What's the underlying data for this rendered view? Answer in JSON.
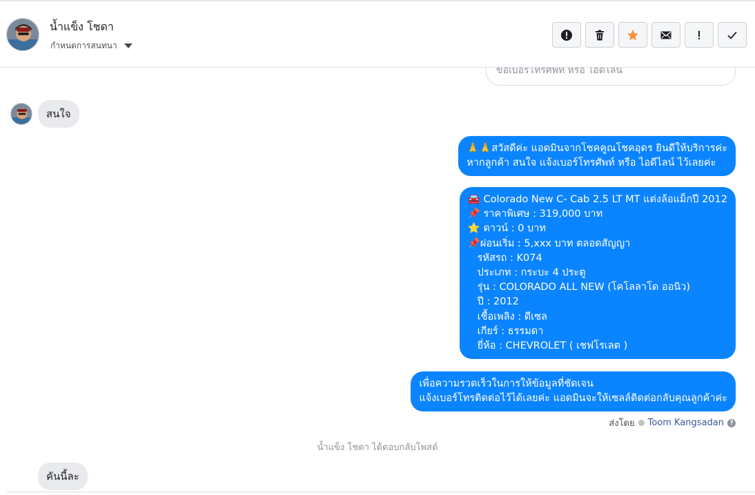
{
  "header": {
    "contact_name": "น้ำแข็ง โชดา",
    "assign_label": "กำหนดการสนทนา",
    "actions": [
      {
        "name": "report-button",
        "icon": "alert-circle-icon"
      },
      {
        "name": "delete-button",
        "icon": "trash-icon"
      },
      {
        "name": "star-button",
        "icon": "star-icon"
      },
      {
        "name": "mark-unread-button",
        "icon": "envelope-icon"
      },
      {
        "name": "follow-up-button",
        "icon": "exclamation-icon"
      },
      {
        "name": "mark-done-button",
        "icon": "checkmark-icon"
      }
    ]
  },
  "thread": {
    "cut_message_text": "ขอเบอร์โทรศัพท์ หรือ ไอดีไลน์",
    "incoming_1": "สนใจ",
    "outgoing_1": {
      "lines": [
        "🙏🙏สวัสดีค่ะ แอดมินจากโชคคูณโชคอุดร ยินดีให้บริการค่ะ",
        "หากลูกค้า สนใจ แจ้งเบอร์โทรศัพท์ หรือ ไอดีไลน์  ไว้เลยค่ะ"
      ]
    },
    "outgoing_2": {
      "lines": [
        "🚘 Colorado New C- Cab 2.5 LT MT แต่งล้อแม็กปี 2012",
        "📌 ราคาพิเศษ : 319,000 บาท",
        "⭐ ดาวน์ : 0 บาท",
        "📌ผ่อนเริ่ม : 5,xxx บาท ตลอดสัญญา",
        "   รหัสรถ : K074",
        "   ประเภท : กระบะ 4 ประตู",
        "   รุ่น : COLORADO ALL NEW (โคโลลาโด ออนิว)",
        "   ปี : 2012",
        "   เชื้อเพลิง : ดีเซล",
        "   เกียร์ : ธรรมดา",
        "   ยี่ห้อ : CHEVROLET ( เชฟโรเลต )"
      ]
    },
    "outgoing_3": {
      "lines": [
        "เพื่อความรวดเร็วในการให้ข้อมูลที่ชัดเจน",
        "แจ้งเบอร์โทรติดต่อไว้ได้เลยค่ะ แอดมินจะให้เซลล์ติดต่อกลับคุณลูกค้าค่ะ"
      ]
    },
    "sent_by_label": "ส่งโดย",
    "sent_by_name": "Toom Kangsadan",
    "system_note": "น้ำแข็ง โชดา ได้ตอบกลับโพสต์",
    "incoming_2": "คันนี้ละ"
  },
  "colors": {
    "outgoing_bubble": "#0b84ff",
    "incoming_bubble": "#e9eaed",
    "star_active": "#f7923b"
  }
}
